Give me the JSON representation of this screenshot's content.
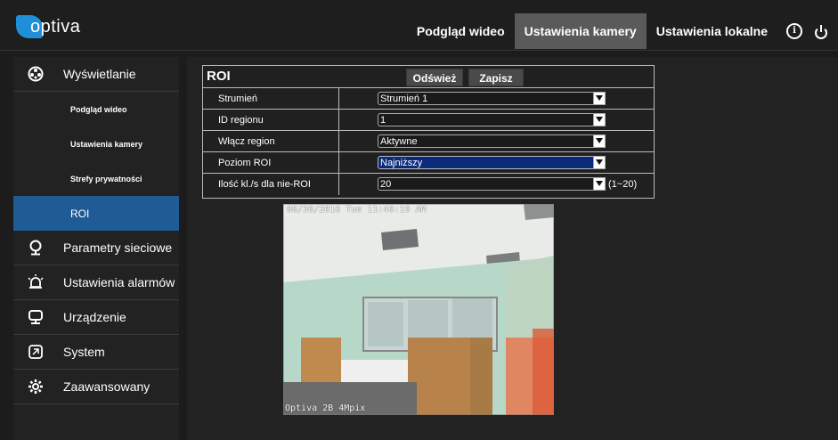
{
  "header": {
    "logo_text": "optiva",
    "tabs": [
      {
        "label": "Podgląd wideo",
        "active": false
      },
      {
        "label": "Ustawienia kamery",
        "active": true
      },
      {
        "label": "Ustawienia lokalne",
        "active": false
      }
    ],
    "icons": [
      "info-icon",
      "power-icon"
    ]
  },
  "sidebar": {
    "sections": [
      {
        "label": "Wyświetlanie",
        "icon": "display-icon",
        "expanded": true,
        "items": [
          {
            "label": "Podgląd wideo",
            "active": false
          },
          {
            "label": "Ustawienia kamery",
            "active": false
          },
          {
            "label": "Strefy prywatności",
            "active": false
          },
          {
            "label": "ROI",
            "active": true
          }
        ]
      },
      {
        "label": "Parametry sieciowe",
        "icon": "network-icon"
      },
      {
        "label": "Ustawienia alarmów",
        "icon": "alarm-icon"
      },
      {
        "label": "Urządzenie",
        "icon": "device-icon"
      },
      {
        "label": "System",
        "icon": "system-icon"
      },
      {
        "label": "Zaawansowany",
        "icon": "gear-icon"
      }
    ]
  },
  "roi": {
    "title": "ROI",
    "refresh_label": "Odśwież",
    "save_label": "Zapisz",
    "rows": [
      {
        "label": "Strumień",
        "value": "Strumień 1"
      },
      {
        "label": "ID regionu",
        "value": "1"
      },
      {
        "label": "Włącz region",
        "value": "Aktywne"
      },
      {
        "label": "Poziom ROI",
        "value": "Najniższy"
      },
      {
        "label": "Ilość kl./s dla nie-ROI",
        "value": "20",
        "range": "(1~20)"
      }
    ]
  },
  "video": {
    "timestamp": "08/30/2016 Tue 11:46:19 AM",
    "caption": "Optiva 2B 4Mpix"
  },
  "colors": {
    "accent": "#1f5b95",
    "brand": "#1f8fd8",
    "highlight_select": "#0a2a7a",
    "roi_overlay": "#e8734a"
  }
}
